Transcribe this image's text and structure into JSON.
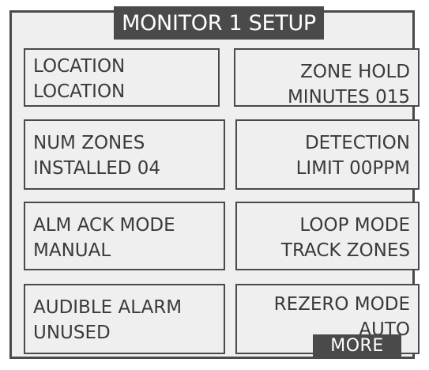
{
  "screen": {
    "title": "MONITOR 1 SETUP",
    "more_label": "MORE"
  },
  "tiles": [
    {
      "line1": "LOCATION",
      "line2": "LOCATION"
    },
    {
      "line1": "ZONE HOLD",
      "line2": "MINUTES 015"
    },
    {
      "line1": "NUM ZONES",
      "line2": "INSTALLED  04"
    },
    {
      "line1": "DETECTION",
      "line2": "LIMIT   00PPM"
    },
    {
      "line1": "ALM  ACK  MODE",
      "line2": "MANUAL"
    },
    {
      "line1": "LOOP MODE",
      "line2": "TRACK ZONES"
    },
    {
      "line1": "AUDIBLE ALARM",
      "line2": "UNUSED"
    },
    {
      "line1": "REZERO MODE",
      "line2": "AUTO"
    }
  ]
}
